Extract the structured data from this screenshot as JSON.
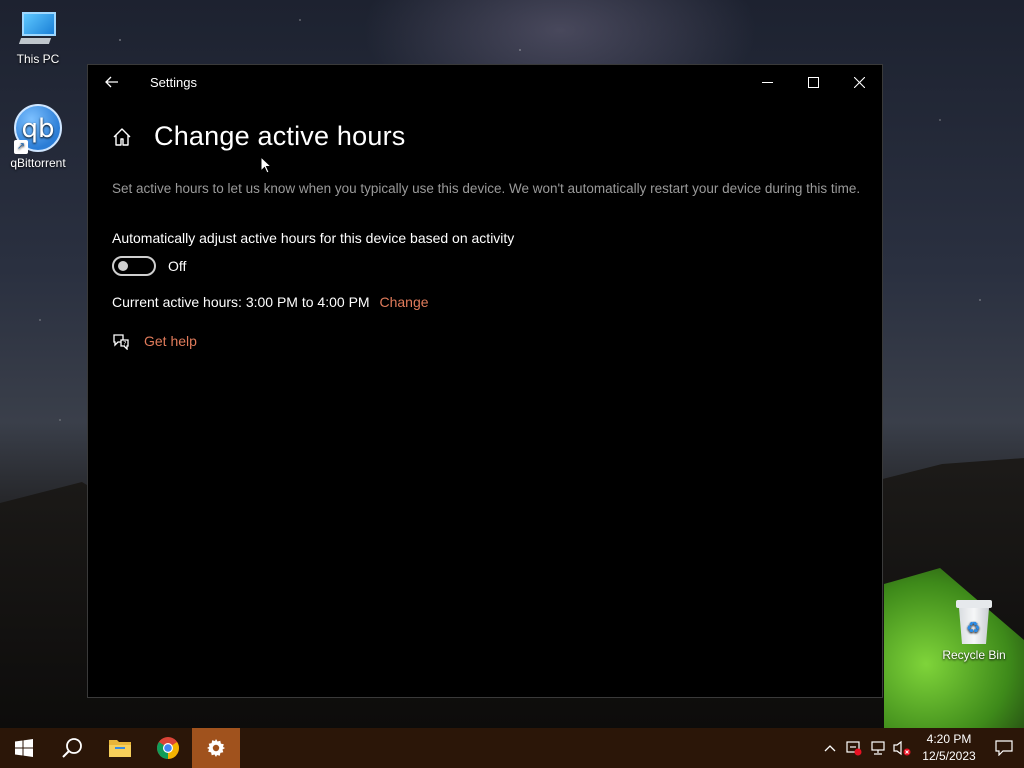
{
  "desktop": {
    "icons": [
      {
        "label": "This PC"
      },
      {
        "label": "qBittorrent",
        "glyph_text": "qb"
      },
      {
        "label": "Recycle Bin"
      }
    ]
  },
  "window": {
    "title": "Settings",
    "controls": {
      "minimize": "—",
      "maximize": "☐",
      "close": "✕"
    }
  },
  "page": {
    "title": "Change active hours",
    "description": "Set active hours to let us know when you typically use this device. We won't automatically restart your device during this time.",
    "auto_adjust_label": "Automatically adjust active hours for this device based on activity",
    "toggle": {
      "state_label": "Off",
      "on": false
    },
    "current_hours": "Current active hours: 3:00 PM to 4:00 PM",
    "change_link": "Change",
    "get_help": "Get help"
  },
  "taskbar": {
    "items": [
      "start",
      "search",
      "file-explorer",
      "chrome",
      "settings"
    ],
    "active_item": "settings",
    "clock": {
      "time": "4:20 PM",
      "date": "12/5/2023"
    }
  },
  "colors": {
    "accent_link": "#e07b5b",
    "taskbar_bg": "#2b1608",
    "taskbar_active": "#a0521d",
    "window_bg": "#000000"
  }
}
